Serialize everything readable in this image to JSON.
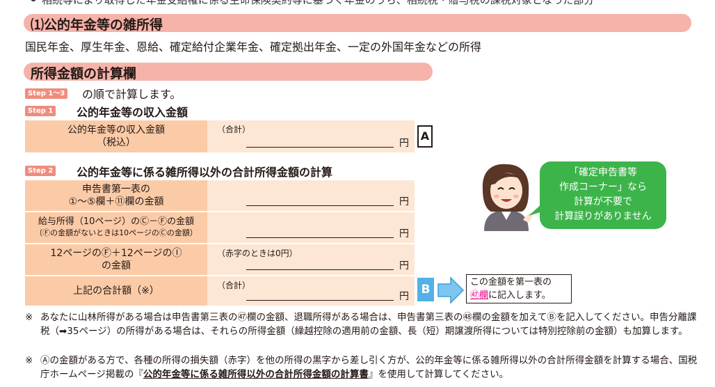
{
  "top_text": "相続等により取得した年金受給権に係る生命保険契約等に基づく年金のうち、相続税・贈与税の課税対象となった部分",
  "section1": {
    "title": "⑴公的年金等の雑所得",
    "desc": "国民年金、厚生年金、恩給、確定給付企業年金、確定拠出年金、一定の外国年金などの所得"
  },
  "section2": {
    "title": "所得金額の計算欄",
    "intro_badge": "Step 1〜3",
    "intro_text": "の順で計算します。",
    "step1": {
      "badge": "Step 1",
      "title": "公的年金等の収入金額",
      "row_label_1": "公的年金等の収入金額",
      "row_label_2": "（税込）",
      "row_note": "（合計）",
      "yen": "円",
      "box": "A"
    },
    "step2": {
      "badge": "Step 2",
      "title": "公的年金等に係る雑所得以外の合計所得金額の計算",
      "rows": [
        {
          "l1": "申告書第一表の",
          "l2": "①〜⑤欄＋⑪欄の金額",
          "note": "",
          "yen": "円"
        },
        {
          "l1": "給与所得（10ページ）のⒸ－Ⓕの金額",
          "l2": "（Ⓕの金額がないときは10ページのⒸの金額）",
          "note": "",
          "yen": "円"
        },
        {
          "l1": "12ページのⒻ＋12ページのⒾ",
          "l2": "の金額",
          "note": "（赤字のときは0円）",
          "yen": "円"
        },
        {
          "l1": "上記の合計額（※）",
          "l2": "",
          "note": "（合計）",
          "yen": "円"
        }
      ],
      "box": "B"
    },
    "callout_1": "この金額を第一表の",
    "callout_link": "㊼欄",
    "callout_2": "に記入します。"
  },
  "bubble": {
    "line1": "「確定申告書等",
    "line2": "作成コーナー」なら",
    "line3": "計算が不要で",
    "line4": "計算誤りがありません"
  },
  "footnotes": {
    "mark": "※",
    "note1": "あなたに山林所得がある場合は申告書第三表の㊼欄の金額、退職所得がある場合は、申告書第三表の㊽欄の金額を加えてⒷを記入してください。申告分離課税（➡35ページ）の所得がある場合は、それらの所得金額（繰越控除の適用前の金額、長（短）期譲渡所得については特別控除前の金額）も加算します。",
    "note2_a": "Ⓐの金額がある方で、各種の所得の損失額（赤字）を他の所得の黒字から差し引く方が、公的年金等に係る雑所得以外の合計所得金額を計算する場合、国税庁ホームページ掲載の『",
    "note2_link": "公的年金等に係る雑所得以外の合計所得金額の計算書",
    "note2_b": "』を使用して計算してください。"
  },
  "colors": {
    "section_header": "#f6b3a9",
    "step_badge": "#f08c7e",
    "label_cell": "#fbcba7",
    "value_cell": "#fde6d4",
    "bubble": "#3cb44a",
    "box_b": "#52b1e6",
    "link": "#e5007f"
  }
}
